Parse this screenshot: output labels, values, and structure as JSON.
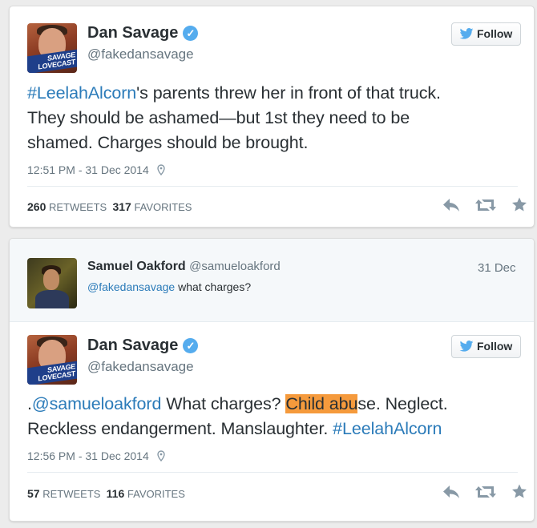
{
  "colors": {
    "link": "#2b7bb9",
    "verified": "#55acee",
    "highlight": "#f59a3c",
    "muted": "#66757f"
  },
  "tweet1": {
    "avatar_label_line1": "SAVAGE",
    "avatar_label_line2": "LOVECAST",
    "name": "Dan Savage",
    "handle": "@fakedansavage",
    "follow_label": "Follow",
    "text_hashtag": "#LeelahAlcorn",
    "text_line1_rest": "'s parents threw her in front of that truck.",
    "text_line2": "They should be ashamed—but 1st they need to be",
    "text_line3": "shamed. Charges should be brought.",
    "timestamp": "12:51 PM - 31 Dec 2014",
    "retweets_count": "260",
    "retweets_label": "RETWEETS",
    "favorites_count": "317",
    "favorites_label": "FAVORITES",
    "icons": [
      "reply-icon",
      "retweet-icon",
      "favorite-icon",
      "location-pin-icon",
      "verified-icon",
      "twitter-bird-icon"
    ]
  },
  "reply": {
    "name": "Samuel Oakford",
    "handle": "@samueloakford",
    "date": "31 Dec",
    "mention": "@fakedansavage",
    "text": " what charges?"
  },
  "tweet2": {
    "avatar_label_line1": "SAVAGE",
    "avatar_label_line2": "LOVECAST",
    "name": "Dan Savage",
    "handle": "@fakedansavage",
    "follow_label": "Follow",
    "text_prefix": ".",
    "text_mention": "@samueloakford",
    "text_part1": " What charges? ",
    "text_highlight": "Child abu",
    "text_part2": "se. Neglect.",
    "text_line2_plain": "Reckless endangerment. Manslaughter. ",
    "text_hashtag": "#LeelahAlcorn",
    "timestamp": "12:56 PM - 31 Dec 2014",
    "retweets_count": "57",
    "retweets_label": "RETWEETS",
    "favorites_count": "116",
    "favorites_label": "FAVORITES"
  }
}
